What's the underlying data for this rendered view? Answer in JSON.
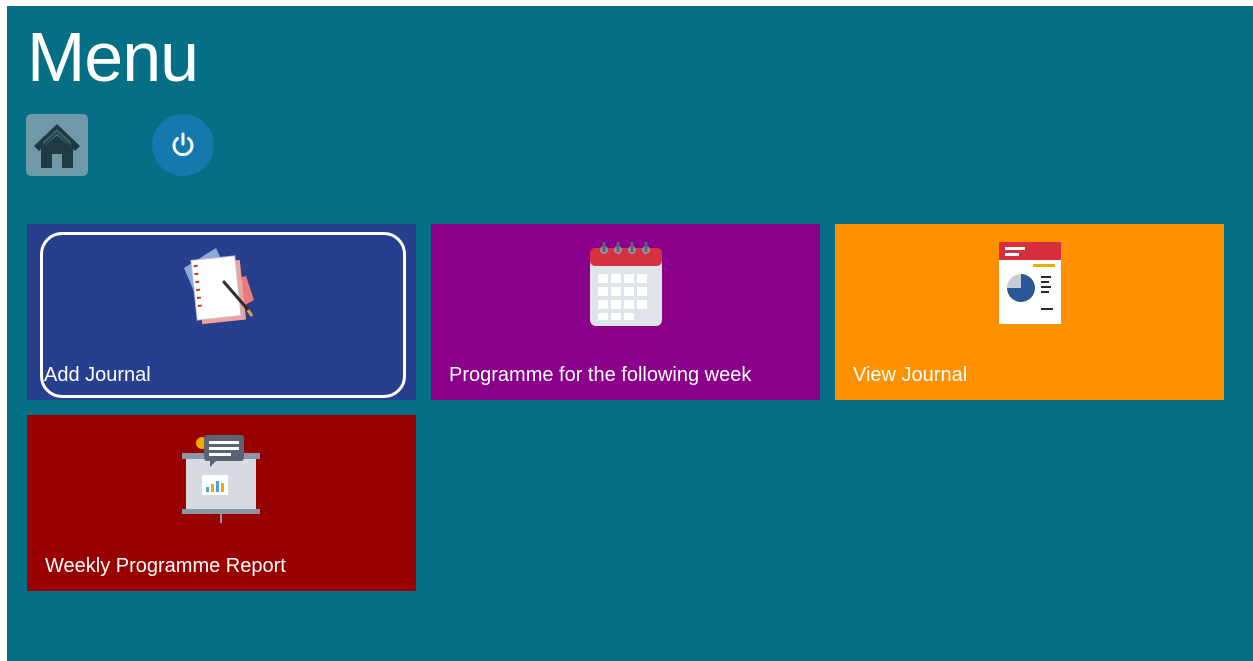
{
  "header": {
    "title": "Menu"
  },
  "toolbar": {
    "home_icon": "home-icon",
    "power_icon": "power-icon"
  },
  "tiles": [
    {
      "label": "Add Journal",
      "icon": "journal-notepad-icon",
      "color": "#283f8e",
      "focused": true
    },
    {
      "label": "Programme for the following week",
      "icon": "calendar-icon",
      "color": "#8b008b"
    },
    {
      "label": "View Journal",
      "icon": "report-document-icon",
      "color": "#ff9100"
    },
    {
      "label": "Weekly Programme Report",
      "icon": "presentation-board-icon",
      "color": "#990000"
    }
  ],
  "colors": {
    "background": "#056f85",
    "home_button": "#6f99a7",
    "power_button": "#1479ad"
  }
}
